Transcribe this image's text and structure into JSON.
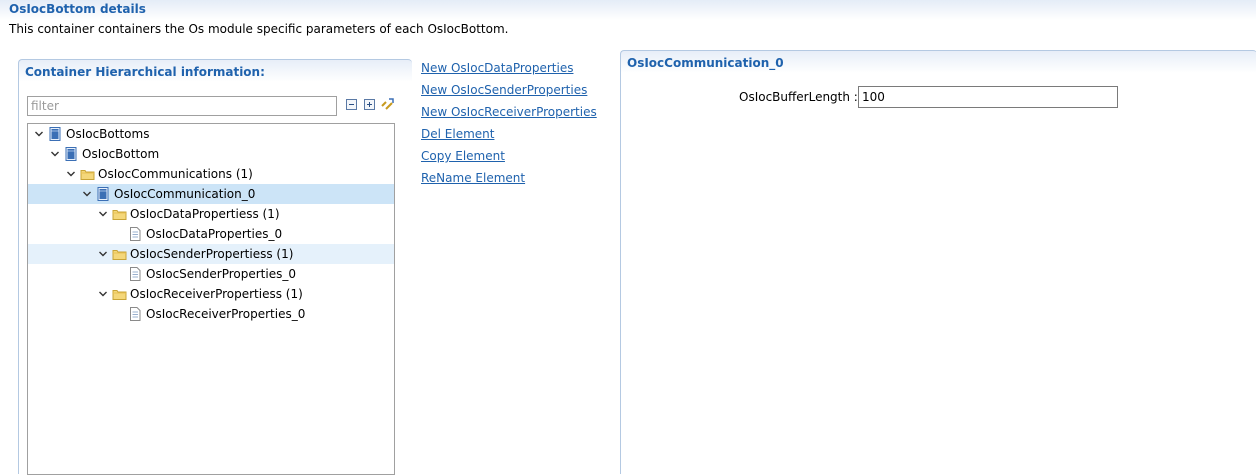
{
  "page": {
    "title": "OsIocBottom details",
    "description": "This container containers the Os module specific parameters of each OsIocBottom."
  },
  "left_panel": {
    "title": "Container Hierarchical information:",
    "filter_placeholder": "filter",
    "toolbar": {
      "collapse_all_icon": "collapse-all-icon",
      "expand_all_icon": "expand-all-icon",
      "link_icon": "link-with-editor-icon"
    },
    "tree": [
      {
        "label": "OsIocBottoms",
        "icon": "module-icon",
        "depth": 0,
        "expanded": true
      },
      {
        "label": "OsIocBottom",
        "icon": "module-icon",
        "depth": 1,
        "expanded": true
      },
      {
        "label": "OsIocCommunications (1)",
        "icon": "folder-icon",
        "depth": 2,
        "expanded": true
      },
      {
        "label": "OsIocCommunication_0",
        "icon": "module-icon",
        "depth": 3,
        "expanded": true,
        "selected": true
      },
      {
        "label": "OsIocDataPropertiess (1)",
        "icon": "folder-icon",
        "depth": 4,
        "expanded": true
      },
      {
        "label": "OsIocDataProperties_0",
        "icon": "file-icon",
        "depth": 5
      },
      {
        "label": "OsIocSenderPropertiess (1)",
        "icon": "folder-icon",
        "depth": 4,
        "expanded": true,
        "hover": true
      },
      {
        "label": "OsIocSenderProperties_0",
        "icon": "file-icon",
        "depth": 5
      },
      {
        "label": "OsIocReceiverPropertiess (1)",
        "icon": "folder-icon",
        "depth": 4,
        "expanded": true
      },
      {
        "label": "OsIocReceiverProperties_0",
        "icon": "file-icon",
        "depth": 5
      }
    ]
  },
  "actions": [
    "New OsIocDataProperties",
    "New OsIocSenderProperties",
    "New OsIocReceiverProperties",
    "Del Element",
    "Copy Element",
    "ReName Element"
  ],
  "right_panel": {
    "title": "OsIocCommunication_0",
    "fields": [
      {
        "label": "OsIocBufferLength :",
        "value": "100"
      }
    ]
  },
  "colors": {
    "accent": "#1f62ad",
    "selection": "#cce4f7",
    "hover": "#e5f1fb",
    "folder": "#f4d77a",
    "module": "#3b6fb5"
  }
}
